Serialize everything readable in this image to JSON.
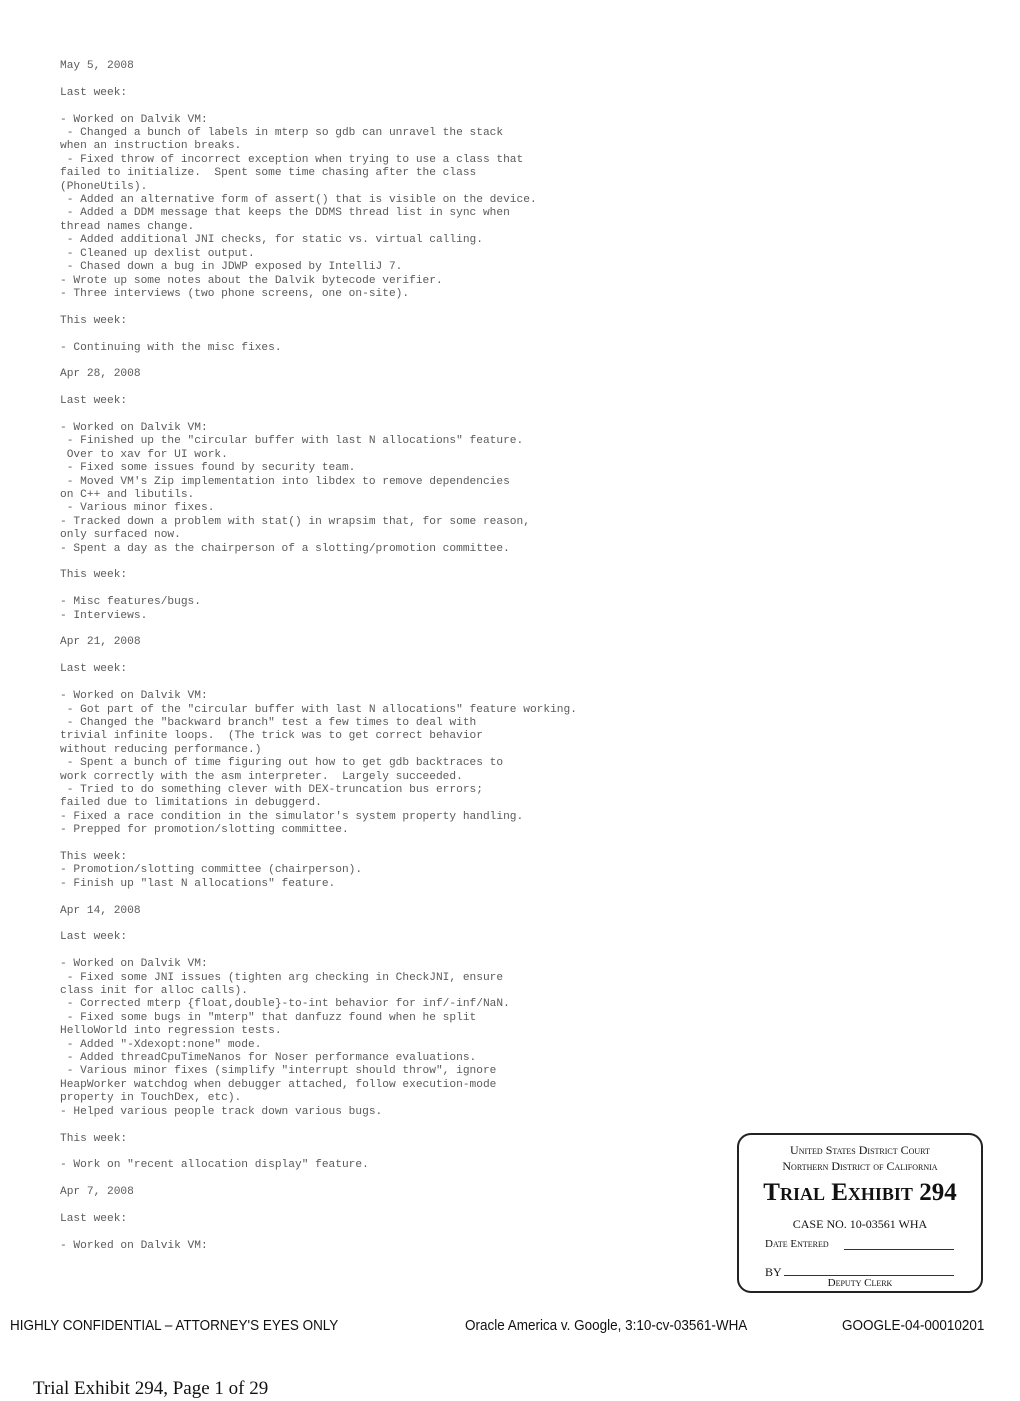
{
  "document": {
    "lines": [
      "May 5, 2008",
      "",
      "Last week:",
      "",
      "- Worked on Dalvik VM:",
      " - Changed a bunch of labels in mterp so gdb can unravel the stack",
      "when an instruction breaks.",
      " - Fixed throw of incorrect exception when trying to use a class that",
      "failed to initialize.  Spent some time chasing after the class",
      "(PhoneUtils).",
      " - Added an alternative form of assert() that is visible on the device.",
      " - Added a DDM message that keeps the DDMS thread list in sync when",
      "thread names change.",
      " - Added additional JNI checks, for static vs. virtual calling.",
      " - Cleaned up dexlist output.",
      " - Chased down a bug in JDWP exposed by IntelliJ 7.",
      "- Wrote up some notes about the Dalvik bytecode verifier.",
      "- Three interviews (two phone screens, one on-site).",
      "",
      "This week:",
      "",
      "- Continuing with the misc fixes.",
      "",
      "Apr 28, 2008",
      "",
      "Last week:",
      "",
      "- Worked on Dalvik VM:",
      " - Finished up the \"circular buffer with last N allocations\" feature.",
      " Over to xav for UI work.",
      " - Fixed some issues found by security team.",
      " - Moved VM's Zip implementation into libdex to remove dependencies",
      "on C++ and libutils.",
      " - Various minor fixes.",
      "- Tracked down a problem with stat() in wrapsim that, for some reason,",
      "only surfaced now.",
      "- Spent a day as the chairperson of a slotting/promotion committee.",
      "",
      "This week:",
      "",
      "- Misc features/bugs.",
      "- Interviews.",
      "",
      "Apr 21, 2008",
      "",
      "Last week:",
      "",
      "- Worked on Dalvik VM:",
      " - Got part of the \"circular buffer with last N allocations\" feature working.",
      " - Changed the \"backward branch\" test a few times to deal with",
      "trivial infinite loops.  (The trick was to get correct behavior",
      "without reducing performance.)",
      " - Spent a bunch of time figuring out how to get gdb backtraces to",
      "work correctly with the asm interpreter.  Largely succeeded.",
      " - Tried to do something clever with DEX-truncation bus errors;",
      "failed due to limitations in debuggerd.",
      "- Fixed a race condition in the simulator's system property handling.",
      "- Prepped for promotion/slotting committee.",
      "",
      "This week:",
      "- Promotion/slotting committee (chairperson).",
      "- Finish up \"last N allocations\" feature.",
      "",
      "Apr 14, 2008",
      "",
      "Last week:",
      "",
      "- Worked on Dalvik VM:",
      " - Fixed some JNI issues (tighten arg checking in CheckJNI, ensure",
      "class init for alloc calls).",
      " - Corrected mterp {float,double}-to-int behavior for inf/-inf/NaN.",
      " - Fixed some bugs in \"mterp\" that danfuzz found when he split",
      "HelloWorld into regression tests.",
      " - Added \"-Xdexopt:none\" mode.",
      " - Added threadCpuTimeNanos for Noser performance evaluations.",
      " - Various minor fixes (simplify \"interrupt should throw\", ignore",
      "HeapWorker watchdog when debugger attached, follow execution-mode",
      "property in TouchDex, etc).",
      "- Helped various people track down various bugs.",
      "",
      "This week:",
      "",
      "- Work on \"recent allocation display\" feature.",
      "",
      "Apr 7, 2008",
      "",
      "Last week:",
      "",
      "- Worked on Dalvik VM:"
    ]
  },
  "stamp": {
    "court_line1": "United States District Court",
    "court_line2": "Northern District of California",
    "exhibit_label": "Trial Exhibit",
    "exhibit_number": "294",
    "case_no": "CASE NO. 10-03561 WHA",
    "date_entered_label": "Date Entered",
    "by_label": "BY",
    "deputy_clerk_label": "Deputy Clerk"
  },
  "footer": {
    "confidentiality": "HIGHLY CONFIDENTIAL – ATTORNEY'S EYES ONLY",
    "case_caption": "Oracle America v. Google, 3:10-cv-03561-WHA",
    "bates_number": "GOOGLE-04-00010201"
  },
  "page_label": "Trial Exhibit 294, Page 1 of 29"
}
